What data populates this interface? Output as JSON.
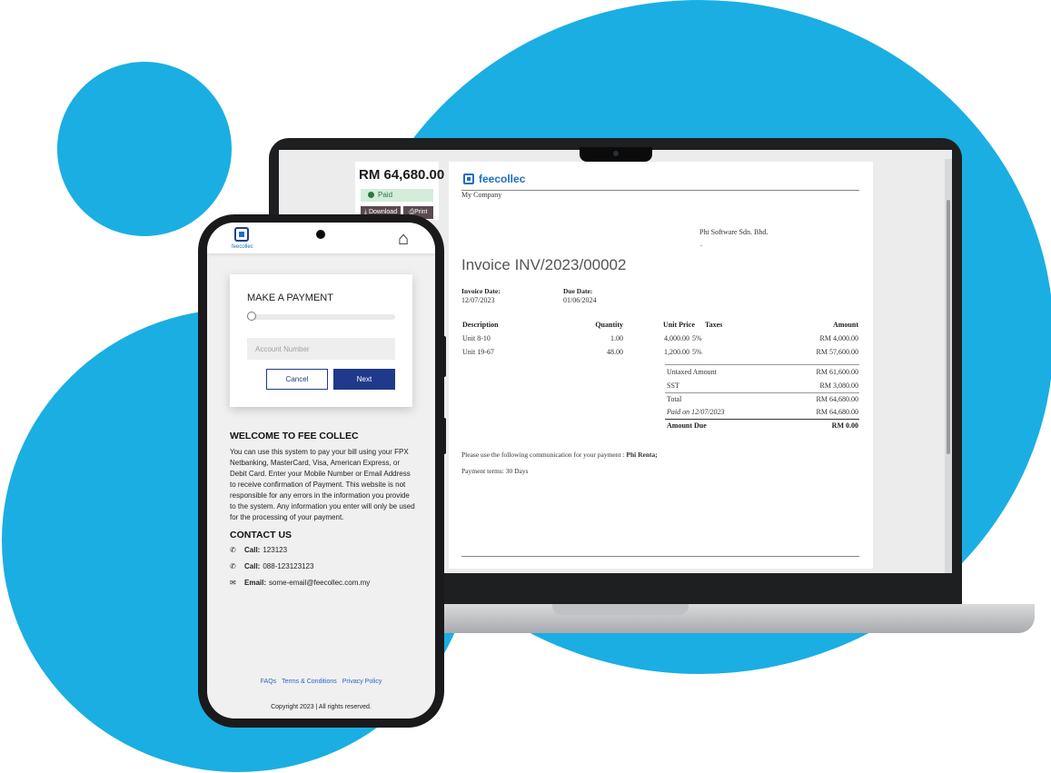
{
  "colors": {
    "brand_blue": "#1aaee3",
    "primary": "#1f3a8a",
    "link": "#2a64c8",
    "paid_bg": "#d4edda"
  },
  "laptop": {
    "summary": {
      "total": "RM 64,680.00",
      "status": "Paid",
      "download_label": "Download",
      "print_label": "Print"
    },
    "invoice": {
      "brand": "feecollec",
      "company": "My Company",
      "partner": "Phi Software Sdn. Bhd.",
      "partner_line2": ".",
      "title": "Invoice INV/2023/00002",
      "invoice_date_label": "Invoice Date:",
      "invoice_date": "12/07/2023",
      "due_date_label": "Due Date:",
      "due_date": "01/06/2024",
      "columns": {
        "description": "Description",
        "quantity": "Quantity",
        "unit_price": "Unit Price",
        "taxes": "Taxes",
        "amount": "Amount"
      },
      "lines": [
        {
          "description": "Unit 8-10",
          "quantity": "1.00",
          "unit_price": "4,000.00",
          "taxes": "5%",
          "amount": "RM 4,000.00"
        },
        {
          "description": "Unit 19-67",
          "quantity": "48.00",
          "unit_price": "1,200.00",
          "taxes": "5%",
          "amount": "RM 57,600.00"
        }
      ],
      "totals": {
        "untaxed_label": "Untaxed Amount",
        "untaxed": "RM 61,600.00",
        "sst_label": "SST",
        "sst": "RM 3,080.00",
        "total_label": "Total",
        "total": "RM 64,680.00",
        "paid_label": "Paid on 12/07/2023",
        "paid": "RM 64,680.00",
        "due_label": "Amount Due",
        "due": "RM 0.00"
      },
      "communication_label": "Please use the following communication for your payment :",
      "communication_value": "Phi Renta;",
      "payment_terms": "Payment terms: 30 Days"
    }
  },
  "phone": {
    "header": {
      "brand": "feecollec",
      "home_icon": "home-icon"
    },
    "payment": {
      "title": "MAKE A PAYMENT",
      "progress": 0,
      "account_placeholder": "Account Number",
      "cancel_label": "Cancel",
      "next_label": "Next"
    },
    "welcome": {
      "title": "WELCOME TO FEE COLLEC",
      "text": "You can use this system to pay your bill using your FPX Netbanking, MasterCard, Visa, American Express, or Debit Card. Enter your Mobile Number or Email Address to receive confirmation of Payment. This website is not responsible for any errors in the information you provide to the system. Any information you enter will only be used for the processing of your payment."
    },
    "contact": {
      "title": "CONTACT US",
      "items": [
        {
          "icon": "phone-icon",
          "label": "Call:",
          "value": "123123"
        },
        {
          "icon": "phone-icon",
          "label": "Call:",
          "value": "088-123123123"
        },
        {
          "icon": "envelope-icon",
          "label": "Email:",
          "value": "some-email@feecollec.com.my"
        }
      ]
    },
    "footer": {
      "links": [
        "FAQs",
        "Terms & Conditions",
        "Privacy Policy"
      ],
      "copyright": "Copyright 2023 | All rights reserved."
    }
  }
}
